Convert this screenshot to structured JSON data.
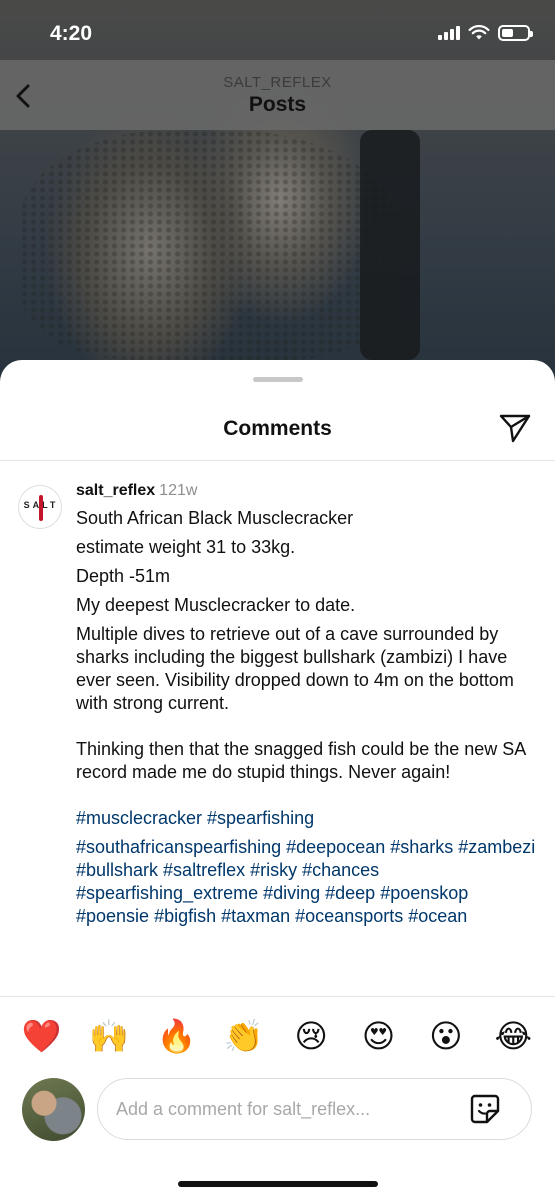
{
  "status_bar": {
    "time": "4:20"
  },
  "header": {
    "subtitle": "SALT_REFLEX",
    "title": "Posts"
  },
  "sheet": {
    "title": "Comments"
  },
  "comment": {
    "username": "salt_reflex",
    "time_ago": "121w",
    "lines": [
      "South African Black Musclecracker",
      "estimate weight 31 to 33kg.",
      "Depth -51m",
      "My deepest Musclecracker to date.",
      "Multiple dives to retrieve out of a cave surrounded by sharks including the biggest bullshark (zambizi) I have ever seen. Visibility dropped down to 4m on the bottom with strong current.",
      "Thinking then that the snagged fish could be the new SA record made me do stupid things. Never again!",
      "#musclecracker #spearfishing",
      "#southafricanspearfishing #deepocean #sharks #zambezi #bullshark #saltreflex #risky #chances #spearfishing_extreme #diving #deep #poenskop #poensie #bigfish #taxman #oceansports #ocean"
    ],
    "avatar_logo_text": "SALT"
  },
  "emoji_bar": [
    "❤️",
    "🙌",
    "🔥",
    "👏",
    "😢",
    "😍",
    "😮",
    "😂"
  ],
  "input": {
    "placeholder": "Add a comment for salt_reflex..."
  },
  "colors": {
    "hashtag": "#00376b",
    "heart": "#ed1d3a",
    "muted": "#8e8e8e"
  },
  "icons": {
    "back": "chevron-left-icon",
    "share": "paper-plane-icon",
    "sticker": "sticker-icon"
  }
}
